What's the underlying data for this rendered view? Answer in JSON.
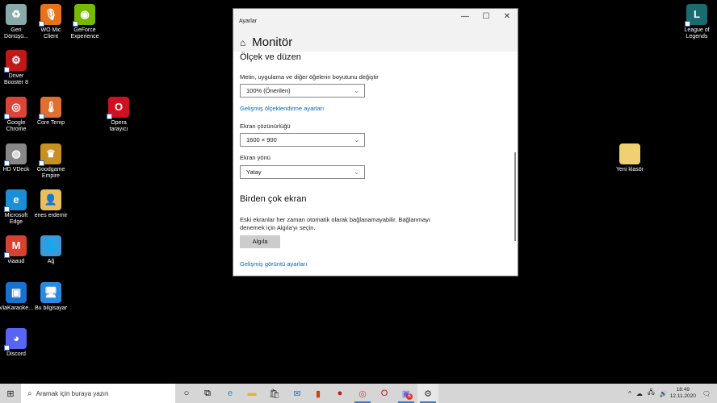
{
  "desktop_icons": [
    {
      "label": "Geri Dönüşü...",
      "icon": "recycle-bin-icon",
      "color": "#8aa",
      "glyph": "♻"
    },
    {
      "label": "WO Mic Client",
      "icon": "microphone-icon",
      "color": "#e8721c",
      "glyph": "🎙"
    },
    {
      "label": "GeForce Experience",
      "icon": "nvidia-icon",
      "color": "#76b900",
      "glyph": "◉"
    },
    {
      "label": "Driver Booster 8",
      "icon": "driver-booster-icon",
      "color": "#c01818",
      "glyph": "⚙"
    },
    {
      "label": "Google Chrome",
      "icon": "chrome-icon",
      "color": "#db4437",
      "glyph": "◎"
    },
    {
      "label": "Core Temp",
      "icon": "thermometer-icon",
      "color": "#e07030",
      "glyph": "🌡"
    },
    {
      "label": "Opera tarayıcı",
      "icon": "opera-icon",
      "color": "#d01020",
      "glyph": "O"
    },
    {
      "label": "HD VDeck",
      "icon": "hd-vdeck-icon",
      "color": "#888",
      "glyph": "◍"
    },
    {
      "label": "Goodgame Empire",
      "icon": "crown-icon",
      "color": "#c89020",
      "glyph": "♛"
    },
    {
      "label": "Microsoft Edge",
      "icon": "edge-icon",
      "color": "#1b8fd6",
      "glyph": "e"
    },
    {
      "label": "enes erdemir",
      "icon": "user-folder-icon",
      "color": "#e8c060",
      "glyph": "👤"
    },
    {
      "label": "viaaud",
      "icon": "viaaud-icon",
      "color": "#d84030",
      "glyph": "M"
    },
    {
      "label": "Ağ",
      "icon": "network-icon",
      "color": "#3a9ad9",
      "glyph": "🌐"
    },
    {
      "label": "ViaKaraoke...",
      "icon": "viakaraoke-icon",
      "color": "#1a70d0",
      "glyph": "▣"
    },
    {
      "label": "Bu bilgisayar",
      "icon": "computer-icon",
      "color": "#2a8ae0",
      "glyph": "🖥"
    },
    {
      "label": "Discord",
      "icon": "discord-icon",
      "color": "#5865f2",
      "glyph": "◕"
    },
    {
      "label": "League of Legends",
      "icon": "league-icon",
      "color": "#1a6a70",
      "glyph": "L"
    },
    {
      "label": "Yeni klasör",
      "icon": "folder-icon",
      "color": "#f0d070",
      "glyph": ""
    }
  ],
  "window": {
    "title": "Ayarlar",
    "page_title": "Monitör",
    "scale_section": "Ölçek ve düzen",
    "scale_label": "Metin, uygulama ve diğer öğelerin boyutunu değiştir",
    "scale_value": "100% (Önerilen)",
    "advanced_scaling_link": "Gelişmiş ölçeklendirme ayarları",
    "resolution_label": "Ekran çözünürlüğü",
    "resolution_value": "1600 × 900",
    "orientation_label": "Ekran yönü",
    "orientation_value": "Yatay",
    "multi_section": "Birden çok ekran",
    "multi_desc_1": "Eski ekranlar her zaman otomatik olarak bağlanamayabilir. Bağlanmayı",
    "multi_desc_2": "denemek için Algıla'yı seçin.",
    "detect_button": "Algıla",
    "advanced_display_link": "Gelişmiş görüntü ayarları"
  },
  "taskbar": {
    "search_placeholder": "Aramak için buraya yazın",
    "time": "18:49",
    "date": "12.11.2020",
    "discord_badge": "6"
  }
}
